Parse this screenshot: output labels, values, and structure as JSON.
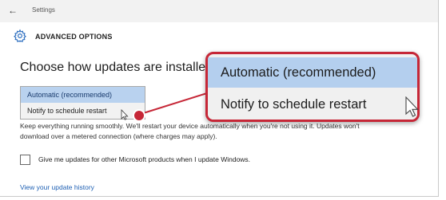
{
  "titlebar": {
    "title": "Settings",
    "back_icon": "back-arrow-icon"
  },
  "header": {
    "title": "ADVANCED OPTIONS",
    "icon": "gear-icon"
  },
  "main": {
    "subtitle": "Choose how updates are installe",
    "dropdown": {
      "options": [
        "Automatic (recommended)",
        "Notify to schedule restart"
      ],
      "selected": "Automatic (recommended)",
      "hovered": "Notify to schedule restart"
    },
    "description_line1": "Keep everything running smoothly. We'll restart your device automatically when you're not using it. Updates won't",
    "description_line2": "download over a metered connection (where charges may apply).",
    "checkbox_label": "Give me updates for other Microsoft products when I update Windows.",
    "checkbox_checked": false,
    "history_link": "View your update history"
  },
  "callout": {
    "options": [
      "Automatic (recommended)",
      "Notify to schedule restart"
    ],
    "accent_color": "#c62737",
    "selected_color": "#b4cfee"
  }
}
